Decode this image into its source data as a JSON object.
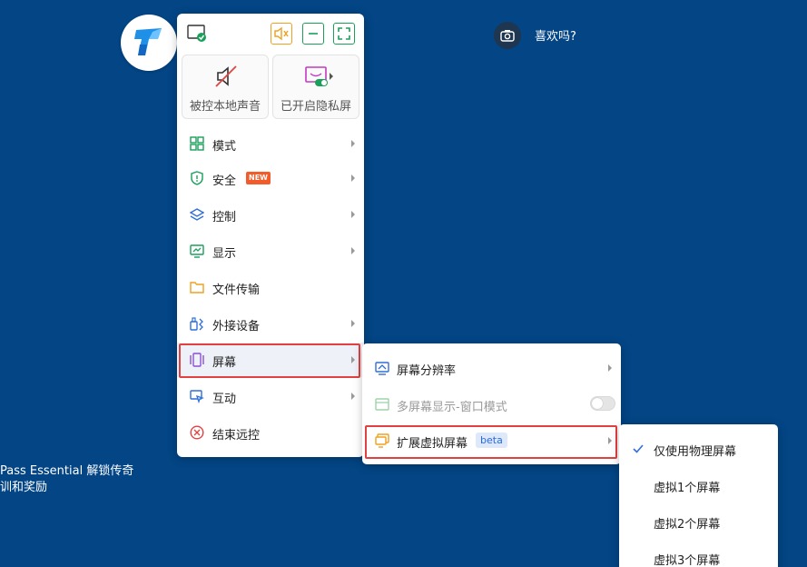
{
  "colors": {
    "background": "#034585",
    "accent_green": "#1aa05a",
    "warning_orange": "#f0a020",
    "highlight_red": "#e14141",
    "beta_blue": "#2d6bd6"
  },
  "top_right": {
    "camera_icon": "camera-icon",
    "like_text": "喜欢吗?"
  },
  "background_text": {
    "line1": "Pass Essential 解锁传奇",
    "line2": "训和奖励"
  },
  "main_menu": {
    "top_buttons": [
      {
        "icon": "screen-check-icon"
      },
      {
        "icon": "mute-icon"
      },
      {
        "icon": "minimize-icon"
      },
      {
        "icon": "fullscreen-icon"
      }
    ],
    "big_buttons": [
      {
        "icon": "speaker-muted-icon",
        "label": "被控本地声音"
      },
      {
        "icon": "privacy-screen-icon",
        "label": "已开启隐私屏"
      }
    ],
    "items": [
      {
        "icon": "grid-icon",
        "label": "模式",
        "has_arrow": true
      },
      {
        "icon": "shield-icon",
        "label": "安全",
        "badge": "NEW",
        "has_arrow": true
      },
      {
        "icon": "layers-icon",
        "label": "控制",
        "has_arrow": true
      },
      {
        "icon": "monitor-chart-icon",
        "label": "显示",
        "has_arrow": true
      },
      {
        "icon": "folder-icon",
        "label": "文件传输",
        "has_arrow": false
      },
      {
        "icon": "usb-device-icon",
        "label": "外接设备",
        "has_arrow": true
      },
      {
        "icon": "screens-icon",
        "label": "屏幕",
        "has_arrow": true,
        "active": true
      },
      {
        "icon": "interact-icon",
        "label": "互动",
        "has_arrow": true
      },
      {
        "icon": "close-circle-icon",
        "label": "结束远控",
        "has_arrow": false
      }
    ]
  },
  "screen_submenu": {
    "items": [
      {
        "icon": "resolution-icon",
        "label": "屏幕分辨率",
        "has_arrow": true
      },
      {
        "icon": "window-mode-icon",
        "label": "多屏幕显示-窗口模式",
        "toggle": false,
        "disabled": true
      },
      {
        "icon": "virtual-screen-icon",
        "label": "扩展虚拟屏幕",
        "badge": "beta",
        "has_arrow": true
      }
    ]
  },
  "virtual_screen_submenu": {
    "items": [
      {
        "label": "仅使用物理屏幕",
        "checked": true
      },
      {
        "label": "虚拟1个屏幕",
        "checked": false
      },
      {
        "label": "虚拟2个屏幕",
        "checked": false
      },
      {
        "label": "虚拟3个屏幕",
        "checked": false
      }
    ]
  }
}
